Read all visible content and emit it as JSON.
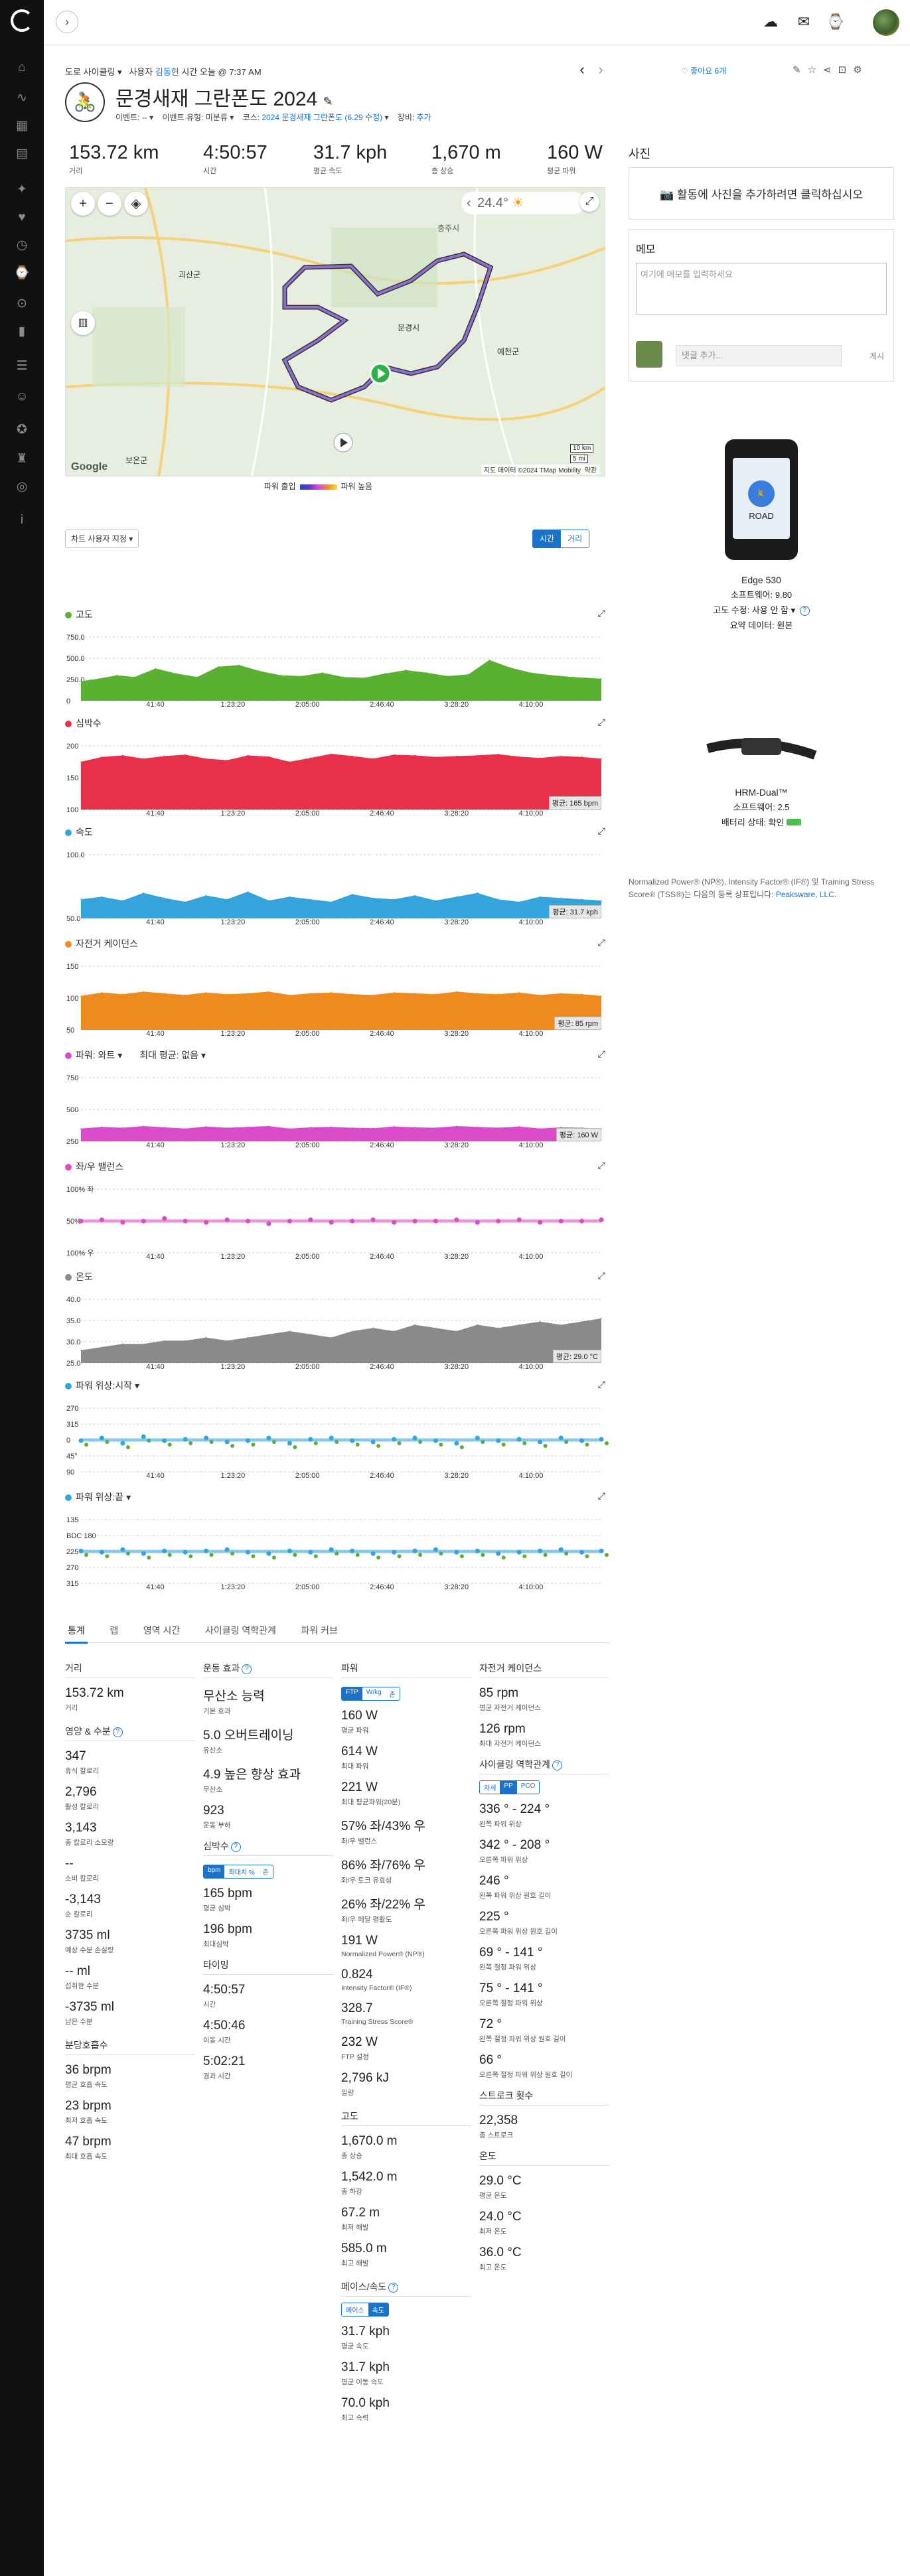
{
  "nav": {
    "icons": [
      "garmin-logo-icon",
      "home-icon",
      "activities-icon",
      "calendar-icon",
      "report-icon",
      "training-icon",
      "health-icon",
      "gear-icon",
      "location-icon",
      "stats-icon",
      "groups-icon",
      "connections-icon",
      "badges-icon",
      "trophy-icon",
      "insights-icon",
      "info-icon"
    ]
  },
  "topbar": {
    "collapse": "›",
    "upload": "☁",
    "inbox": "✉",
    "watch": "⌚"
  },
  "breadcrumb": {
    "sport": "도로 사이클링",
    "user_prefix": "사용자",
    "user": "김동현",
    "time": "시간 오늘 @ 7:37 AM"
  },
  "nav_arrows": {
    "prev": "‹",
    "next": "›"
  },
  "likes": "좋아요 6개",
  "title": "문경새재 그란폰도 2024",
  "sub": {
    "event_label": "이벤트:",
    "event_value": "--",
    "type_label": "이벤트 유형:",
    "type_value": "미분류",
    "course_label": "코스:",
    "course_value": "2024 문경새재 그란폰도 (6.29 수정)",
    "gear_label": "장비:",
    "gear_value": "추가"
  },
  "stats": [
    {
      "value": "153.72 km",
      "label": "거리"
    },
    {
      "value": "4:50:57",
      "label": "시간"
    },
    {
      "value": "31.7 kph",
      "label": "평균 속도"
    },
    {
      "value": "1,670 m",
      "label": "총 상승"
    },
    {
      "value": "160 W",
      "label": "평균 파워"
    }
  ],
  "map": {
    "temp": "24.4°",
    "scale_km": "10 km",
    "scale_mi": "5 mi",
    "attribution": "지도 데이터 ©2024 TMap Mobility",
    "google": "Google",
    "terms": "약관",
    "cities": [
      "문경시",
      "괴산군",
      "예천군",
      "보은군",
      "충주시"
    ]
  },
  "power_legend": {
    "low": "파워 출입",
    "high": "파워 높음"
  },
  "chart_controls": {
    "select": "차트 사용자 지정 ▾",
    "time": "시간",
    "distance": "거리"
  },
  "x_ticks": [
    "41:40",
    "1:23:20",
    "2:05:00",
    "2:46:40",
    "3:28:20",
    "4:10:00"
  ],
  "chart_data": [
    {
      "type": "area",
      "title": "고도",
      "color": "#5ab131",
      "ylim": [
        0,
        750
      ],
      "yticks": [
        "750.0",
        "500.0",
        "250.0",
        "0"
      ],
      "x": [
        0,
        600,
        1200,
        1800,
        2500,
        3200,
        3900,
        4600,
        5300,
        6000,
        6700,
        7400,
        8100,
        8800,
        9500,
        10200,
        10900,
        11600,
        12300,
        13000,
        13700,
        14400,
        15100,
        15800,
        16500,
        17457
      ],
      "values": [
        230,
        260,
        300,
        280,
        380,
        320,
        280,
        400,
        420,
        350,
        300,
        290,
        330,
        280,
        270,
        320,
        360,
        330,
        290,
        310,
        480,
        390,
        330,
        300,
        280,
        260
      ]
    },
    {
      "type": "area",
      "title": "심박수",
      "color": "#e8304a",
      "ylim": [
        0,
        200
      ],
      "yticks": [
        "200",
        "150",
        "100"
      ],
      "avg": "평균: 165 bpm",
      "x": [
        0,
        700,
        1400,
        2100,
        2800,
        3500,
        4200,
        4900,
        5600,
        6300,
        7000,
        7700,
        8400,
        9100,
        9800,
        10500,
        11200,
        11900,
        12600,
        13300,
        14000,
        14700,
        15400,
        16100,
        16800,
        17457
      ],
      "values": [
        150,
        165,
        170,
        160,
        168,
        172,
        160,
        155,
        170,
        166,
        150,
        162,
        175,
        168,
        160,
        172,
        170,
        165,
        168,
        170,
        174,
        166,
        162,
        168,
        165,
        160
      ]
    },
    {
      "type": "area",
      "title": "속도",
      "color": "#33a5dc",
      "ylim": [
        0,
        100
      ],
      "yticks": [
        "100.0",
        "50.0"
      ],
      "avg": "평균: 31.7 kph",
      "x": [
        0,
        700,
        1400,
        2100,
        2800,
        3500,
        4200,
        4900,
        5600,
        6300,
        7000,
        7700,
        8400,
        9100,
        9800,
        10500,
        11200,
        11900,
        12600,
        13300,
        14000,
        14700,
        15400,
        16100,
        16800,
        17457
      ],
      "values": [
        30,
        34,
        28,
        40,
        32,
        26,
        36,
        30,
        42,
        28,
        34,
        30,
        26,
        38,
        32,
        30,
        36,
        28,
        34,
        40,
        30,
        26,
        34,
        32,
        30,
        28
      ]
    },
    {
      "type": "area",
      "title": "자전거 케이던스",
      "color": "#ef8a1f",
      "ylim": [
        0,
        150
      ],
      "yticks": [
        "150",
        "100",
        "50"
      ],
      "avg": "평균: 85 rpm",
      "x": [
        0,
        700,
        1400,
        2100,
        2800,
        3500,
        4200,
        4900,
        5600,
        6300,
        7000,
        7700,
        8400,
        9100,
        9800,
        10500,
        11200,
        11900,
        12600,
        13300,
        14000,
        14700,
        15400,
        16100,
        16800,
        17457
      ],
      "values": [
        80,
        88,
        84,
        90,
        86,
        82,
        88,
        84,
        86,
        90,
        82,
        86,
        88,
        84,
        82,
        88,
        86,
        84,
        90,
        86,
        84,
        88,
        82,
        86,
        84,
        80
      ]
    },
    {
      "type": "area",
      "title": "파워: 와트 ▾",
      "subtitle": "최대 평균: 없음 ▾",
      "color": "#d94bc8",
      "ylim": [
        0,
        750
      ],
      "yticks": [
        "750",
        "500",
        "250"
      ],
      "avg": "평균: 160 W",
      "x": [
        0,
        700,
        1400,
        2100,
        2800,
        3500,
        4200,
        4900,
        5600,
        6300,
        7000,
        7700,
        8400,
        9100,
        9800,
        10500,
        11200,
        11900,
        12600,
        13300,
        14000,
        14700,
        15400,
        16100,
        16800,
        17457
      ],
      "values": [
        150,
        170,
        160,
        180,
        165,
        150,
        175,
        160,
        170,
        180,
        150,
        165,
        170,
        160,
        155,
        175,
        165,
        160,
        180,
        170,
        160,
        175,
        150,
        165,
        160,
        150
      ]
    },
    {
      "type": "scatter",
      "title": "좌/우 밸런스",
      "color": "#d94bc8",
      "yticks": [
        "100% 좌",
        "50%",
        "100% 우"
      ],
      "x": [
        0,
        700,
        1400,
        2100,
        2800,
        3500,
        4200,
        4900,
        5600,
        6300,
        7000,
        7700,
        8400,
        9100,
        9800,
        10500,
        11200,
        11900,
        12600,
        13300,
        14000,
        14700,
        15400,
        16100,
        16800,
        17457
      ],
      "values": [
        57,
        56,
        58,
        57,
        55,
        57,
        58,
        56,
        57,
        59,
        57,
        56,
        58,
        57,
        56,
        58,
        57,
        57,
        56,
        58,
        57,
        56,
        58,
        57,
        57,
        56
      ]
    },
    {
      "type": "area",
      "title": "온도",
      "color": "#8a8a8a",
      "ylim": [
        20,
        40
      ],
      "yticks": [
        "40.0",
        "35.0",
        "30.0",
        "25.0"
      ],
      "avg": "평균: 29.0 °C",
      "x": [
        0,
        700,
        1400,
        2100,
        2800,
        3500,
        4200,
        4900,
        5600,
        6300,
        7000,
        7700,
        8400,
        9100,
        9800,
        10500,
        11200,
        11900,
        12600,
        13300,
        14000,
        14700,
        15400,
        16100,
        16800,
        17457
      ],
      "values": [
        24,
        25,
        26,
        26,
        27,
        27,
        28,
        27,
        28,
        29,
        30,
        29,
        28,
        30,
        31,
        30,
        32,
        31,
        30,
        32,
        31,
        32,
        33,
        32,
        33,
        34
      ]
    },
    {
      "type": "scatter",
      "title": "파워 위상:시작 ▾",
      "color": "#33a5dc",
      "color2": "#5ab131",
      "yticks": [
        "270",
        "315",
        "0",
        "45°",
        "90"
      ],
      "x": [
        0,
        700,
        1400,
        2100,
        2800,
        3500,
        4200,
        4900,
        5600,
        6300,
        7000,
        7700,
        8400,
        9100,
        9800,
        10500,
        11200,
        11900,
        12600,
        13300,
        14000,
        14700,
        15400,
        16100,
        16800,
        17457
      ],
      "values": [
        338,
        336,
        340,
        335,
        338,
        337,
        336,
        339,
        338,
        336,
        340,
        337,
        336,
        338,
        339,
        337,
        336,
        338,
        340,
        336,
        338,
        337,
        339,
        336,
        338,
        337
      ]
    },
    {
      "type": "scatter",
      "title": "파워 위상:끝 ▾",
      "color": "#33a5dc",
      "color2": "#5ab131",
      "yticks": [
        "135",
        "BDC 180",
        "225",
        "270",
        "315"
      ],
      "x": [
        0,
        700,
        1400,
        2100,
        2800,
        3500,
        4200,
        4900,
        5600,
        6300,
        7000,
        7700,
        8400,
        9100,
        9800,
        10500,
        11200,
        11900,
        12600,
        13300,
        14000,
        14700,
        15400,
        16100,
        16800,
        17457
      ],
      "values": [
        224,
        225,
        223,
        226,
        224,
        225,
        224,
        223,
        225,
        226,
        224,
        225,
        223,
        224,
        226,
        225,
        224,
        223,
        225,
        224,
        226,
        225,
        224,
        223,
        225,
        224
      ]
    }
  ],
  "tabs": [
    "통계",
    "랩",
    "영역 시간",
    "사이클링 역학관계",
    "파워 커브"
  ],
  "col1": {
    "distance": {
      "title": "거리",
      "items": [
        {
          "v": "153.72 km",
          "l": "거리"
        }
      ]
    },
    "calories": {
      "title": "영양 & 수분",
      "items": [
        {
          "v": "347",
          "l": "휴식 칼로리"
        },
        {
          "v": "2,796",
          "l": "활성 칼로리"
        },
        {
          "v": "3,143",
          "l": "총 칼로리 소모량"
        },
        {
          "v": "--",
          "l": "소비 칼로리"
        },
        {
          "v": "-3,143",
          "l": "순 칼로리"
        },
        {
          "v": "3735 ml",
          "l": "예상 수분 손실량"
        },
        {
          "v": "-- ml",
          "l": "섭취한 수분"
        },
        {
          "v": "-3735 ml",
          "l": "남은 수분"
        }
      ]
    },
    "breathing": {
      "title": "분당호흡수",
      "items": [
        {
          "v": "36 brpm",
          "l": "평균 호흡 속도"
        },
        {
          "v": "23 brpm",
          "l": "최저 호흡 속도"
        },
        {
          "v": "47 brpm",
          "l": "최대 호흡 속도"
        }
      ]
    }
  },
  "col2": {
    "effect": {
      "title": "운동 효과",
      "items": [
        {
          "v": "무산소 능력",
          "l": "기본 효과"
        },
        {
          "v": "5.0 오버트레이닝",
          "l": "유산소"
        },
        {
          "v": "4.9 높은 향상 효과",
          "l": "무산소"
        },
        {
          "v": "923",
          "l": "운동 부하"
        }
      ]
    },
    "hr": {
      "title": "심박수",
      "seg": [
        "bpm",
        "최대치 %",
        "존"
      ],
      "items": [
        {
          "v": "165 bpm",
          "l": "평균 심박"
        },
        {
          "v": "196 bpm",
          "l": "최대심박"
        }
      ]
    },
    "timing": {
      "title": "타이밍",
      "items": [
        {
          "v": "4:50:57",
          "l": "시간"
        },
        {
          "v": "4:50:46",
          "l": "이동 시간"
        },
        {
          "v": "5:02:21",
          "l": "경과 시간"
        }
      ]
    }
  },
  "col3": {
    "power": {
      "title": "파워",
      "seg": [
        "FTP",
        "W/kg",
        "존"
      ],
      "items": [
        {
          "v": "160 W",
          "l": "평균 파워"
        },
        {
          "v": "614 W",
          "l": "최대 파워"
        },
        {
          "v": "221 W",
          "l": "최대 평균파워(20분)"
        },
        {
          "v": "57% 좌/43% 우",
          "l": "좌/우 밸런스"
        },
        {
          "v": "86% 좌/76% 우",
          "l": "좌/우 토크 유효성"
        },
        {
          "v": "26% 좌/22% 우",
          "l": "좌/우 페달 평활도"
        },
        {
          "v": "191 W",
          "l": "Normalized Power® (NP®)"
        },
        {
          "v": "0.824",
          "l": "Intensity Factor® (IF®)"
        },
        {
          "v": "328.7",
          "l": "Training Stress Score®"
        },
        {
          "v": "232 W",
          "l": "FTP 설정"
        },
        {
          "v": "2,796 kJ",
          "l": "일량"
        }
      ]
    },
    "elev": {
      "title": "고도",
      "items": [
        {
          "v": "1,670.0 m",
          "l": "총 상승"
        },
        {
          "v": "1,542.0 m",
          "l": "총 하강"
        },
        {
          "v": "67.2 m",
          "l": "최저 해발"
        },
        {
          "v": "585.0 m",
          "l": "최고 해발"
        }
      ]
    },
    "pace": {
      "title": "페이스/속도",
      "seg": [
        "페이스",
        "속도"
      ],
      "items": [
        {
          "v": "31.7 kph",
          "l": "평균 속도"
        },
        {
          "v": "31.7 kph",
          "l": "평균 이동 속도"
        },
        {
          "v": "70.0 kph",
          "l": "최고 속력"
        }
      ]
    }
  },
  "col4": {
    "cadence": {
      "title": "자전거 케이던스",
      "items": [
        {
          "v": "85 rpm",
          "l": "평균 자전거 케이던스"
        },
        {
          "v": "126 rpm",
          "l": "최대 자전거 케이던스"
        }
      ]
    },
    "dyn": {
      "title": "사이클링 역학관계",
      "seg": [
        "자세",
        "PP",
        "PCO"
      ],
      "items": [
        {
          "v": "336 ° - 224 °",
          "l": "왼쪽 파워 위상"
        },
        {
          "v": "342 ° - 208 °",
          "l": "오른쪽 파워 위상"
        },
        {
          "v": "246 °",
          "l": "왼쪽 파워 위상 원호 길이"
        },
        {
          "v": "225 °",
          "l": "오른쪽 파워 위상 원호 길이"
        },
        {
          "v": "69 ° - 141 °",
          "l": "왼쪽 절정 파워 위상"
        },
        {
          "v": "75 ° - 141 °",
          "l": "오른쪽 절정 파워 위상"
        },
        {
          "v": "72 °",
          "l": "왼쪽 절정 파워 위상 원호 길이"
        },
        {
          "v": "66 °",
          "l": "오른쪽 절정 파워 위상 원호 길이"
        }
      ]
    },
    "strokes": {
      "title": "스트로크 횟수",
      "items": [
        {
          "v": "22,358",
          "l": "총 스트로크"
        }
      ]
    },
    "temp": {
      "title": "온도",
      "items": [
        {
          "v": "29.0 °C",
          "l": "평균 온도"
        },
        {
          "v": "24.0 °C",
          "l": "최저 온도"
        },
        {
          "v": "36.0 °C",
          "l": "최고 온도"
        }
      ]
    }
  },
  "side": {
    "photos_title": "사진",
    "photos_add": "활동에 사진을 추가하려면 클릭하십시오",
    "notes_title": "메모",
    "notes_placeholder": "여기에 메모를 입력하세요",
    "comment_placeholder": "댓글 추가...",
    "comment_post": "게시",
    "device1": {
      "name": "Edge 530",
      "sw": "소프트웨어: 9.80",
      "elev": "고도 수정: 사용 안 함 ▾",
      "summary": "요약 데이터: 원본",
      "screen": "ROAD"
    },
    "device2": {
      "name": "HRM-Dual™",
      "sw": "소프트웨어: 2.5",
      "battery": "배터리 상태: 확인"
    },
    "trademark": "Normalized Power® (NP®), Intensity Factor® (IF®) 및 Training Stress Score® (TSS®)는 다음의 등록 상표입니다:",
    "trademark_link": "Peaksware, LLC."
  }
}
